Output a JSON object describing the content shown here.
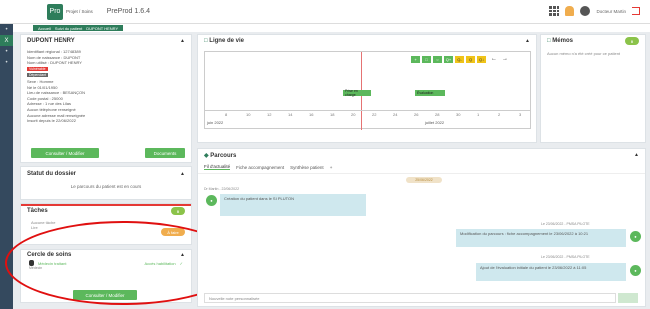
{
  "app": {
    "logo_label": "Pro",
    "logo_text": "Projet / Soins",
    "title": "PreProd 1.6.4",
    "user": "Docteur Martin"
  },
  "breadcrumb": {
    "home": "Accueil",
    "item1": "Suivi du patient",
    "item2": "DUPONT HENRY"
  },
  "rail": [
    "•",
    "X",
    "•",
    "•"
  ],
  "patient": {
    "name": "DUPONT HENRY",
    "lines": [
      "Identifiant régional : 12748389",
      "Nom de naissance : DUPONT",
      "Nom utilisé : DUPONT HENRY",
      "Sexe : Homme",
      "Né le 01/01/1950",
      "Lieu de naissance : BESANÇON",
      "Code postal : 25000",
      "Adresse : 1 rue des Lilas",
      "Aucun téléphone renseigné",
      "Aucune adresse mail renseignée",
      "Inscrit depuis le 22/06/2022"
    ],
    "tag_red": "Vulnérable",
    "tag_grey": "Dépendant",
    "consult_btn": "Consulter / Modifier",
    "docs_btn": "Documents"
  },
  "statut": {
    "title": "Statut du dossier",
    "text": "Le parcours du patient est en cours"
  },
  "taches": {
    "title": "Tâches",
    "count": "0",
    "item_label": "Aucune tâche",
    "item_sub": "Lire",
    "pill": "À faire"
  },
  "cercle": {
    "title": "Cercle de soins",
    "member": "Médecin traitant",
    "role": "Médecin",
    "status": "Accès habilitation",
    "consult_btn": "Consulter / Modifier"
  },
  "timeline": {
    "title": "Ligne de vie",
    "ticks": [
      "8",
      "10",
      "12",
      "14",
      "16",
      "18",
      "20",
      "22",
      "24",
      "26",
      "28",
      "30",
      "1",
      "2",
      "3"
    ],
    "left_label": "juin 2022",
    "right_label": "juillet 2022",
    "event1": "Prise en charge",
    "event2": "Évaluation",
    "tools": [
      "+",
      "□",
      "○",
      "Q+",
      "Q-",
      "Q",
      "Q↓"
    ]
  },
  "memos": {
    "title": "Mémos",
    "count": "0",
    "text": "Aucun mémo n'a été créé pour ce patient"
  },
  "parcours": {
    "title": "Parcours",
    "tabs": [
      "Fil d'actualité",
      "Fiche accompagnement",
      "Synthèse patient",
      "+"
    ],
    "date_pill": "25/06/2022",
    "msg1_meta": "Dr Martin - 22/06/2022",
    "msg1": "Création du patient dans le SI PLUTON",
    "msg2_meta": "Le 23/06/2022 - PMSA PILOTE",
    "msg2": "Modification du parcours : fiche accompagnement le 23/06/2022 à 10:21",
    "msg3_meta": "Le 23/06/2022 - PMSA PILOTE",
    "msg3": "Ajout de l'évaluation initiale du patient le 23/06/2022 à 11:05",
    "composer": "Nouvelle note personnalisée"
  },
  "colors": {
    "brand": "#2e7d5b",
    "green": "#5cb85c",
    "highlight": "#e01010"
  }
}
